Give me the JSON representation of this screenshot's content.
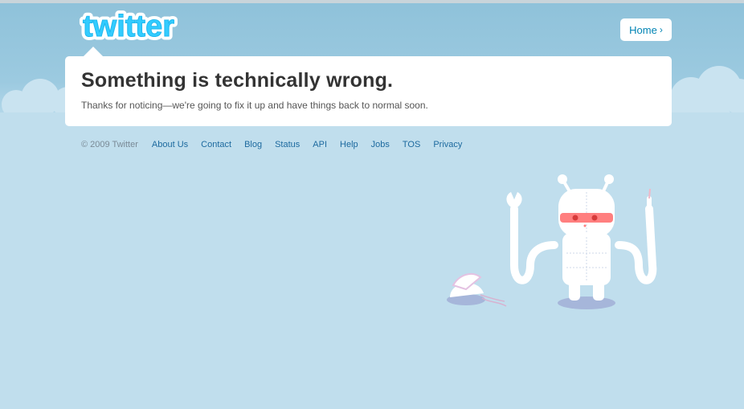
{
  "header": {
    "logo_alt": "twitter",
    "home_label": "Home",
    "home_chevron": "›"
  },
  "error": {
    "title": "Something is technically wrong.",
    "message": "Thanks for noticing—we're going to fix it up and have things back to normal soon."
  },
  "footer": {
    "copyright": "© 2009 Twitter",
    "links": [
      "About Us",
      "Contact",
      "Blog",
      "Status",
      "API",
      "Help",
      "Jobs",
      "TOS",
      "Privacy"
    ]
  },
  "colors": {
    "background": "#c0deed",
    "sky": "#8fc2da",
    "link": "#0084b4",
    "logo": "#33ccff",
    "robot_visor": "#ff7f7f"
  },
  "icons": [
    "twitter-logo",
    "chevron-right-icon",
    "robot-illustration",
    "broken-robot-head"
  ]
}
